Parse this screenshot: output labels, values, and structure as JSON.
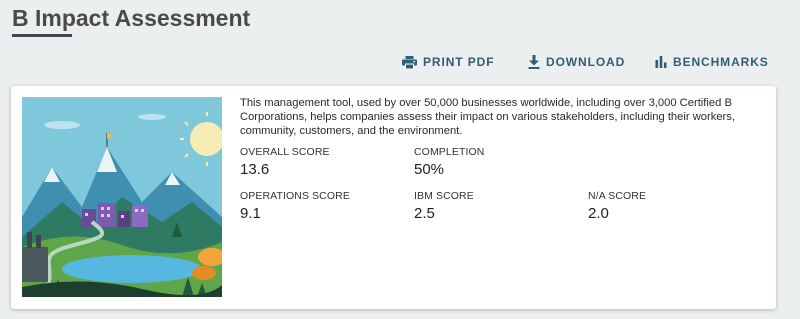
{
  "page": {
    "title": "B Impact Assessment"
  },
  "toolbar": {
    "print_label": "PRINT PDF",
    "download_label": "DOWNLOAD",
    "benchmarks_label": "BENCHMARKS",
    "print_icon": "printer-icon",
    "download_icon": "download-icon",
    "benchmarks_icon": "bar-chart-icon",
    "accent_color": "#2f5d73"
  },
  "card": {
    "description": "This management tool, used by over 50,000 businesses worldwide, including over 3,000 Certified B Corporations, helps companies assess their impact on various stakeholders, including their workers, community, customers, and the environment.",
    "scores": {
      "overall": {
        "label": "OVERALL SCORE",
        "value": "13.6"
      },
      "completion": {
        "label": "COMPLETION",
        "value": "50%"
      },
      "operations": {
        "label": "OPERATIONS SCORE",
        "value": "9.1"
      },
      "ibm": {
        "label": "IBM SCORE",
        "value": "2.5"
      },
      "na": {
        "label": "N/A SCORE",
        "value": "2.0"
      }
    }
  }
}
